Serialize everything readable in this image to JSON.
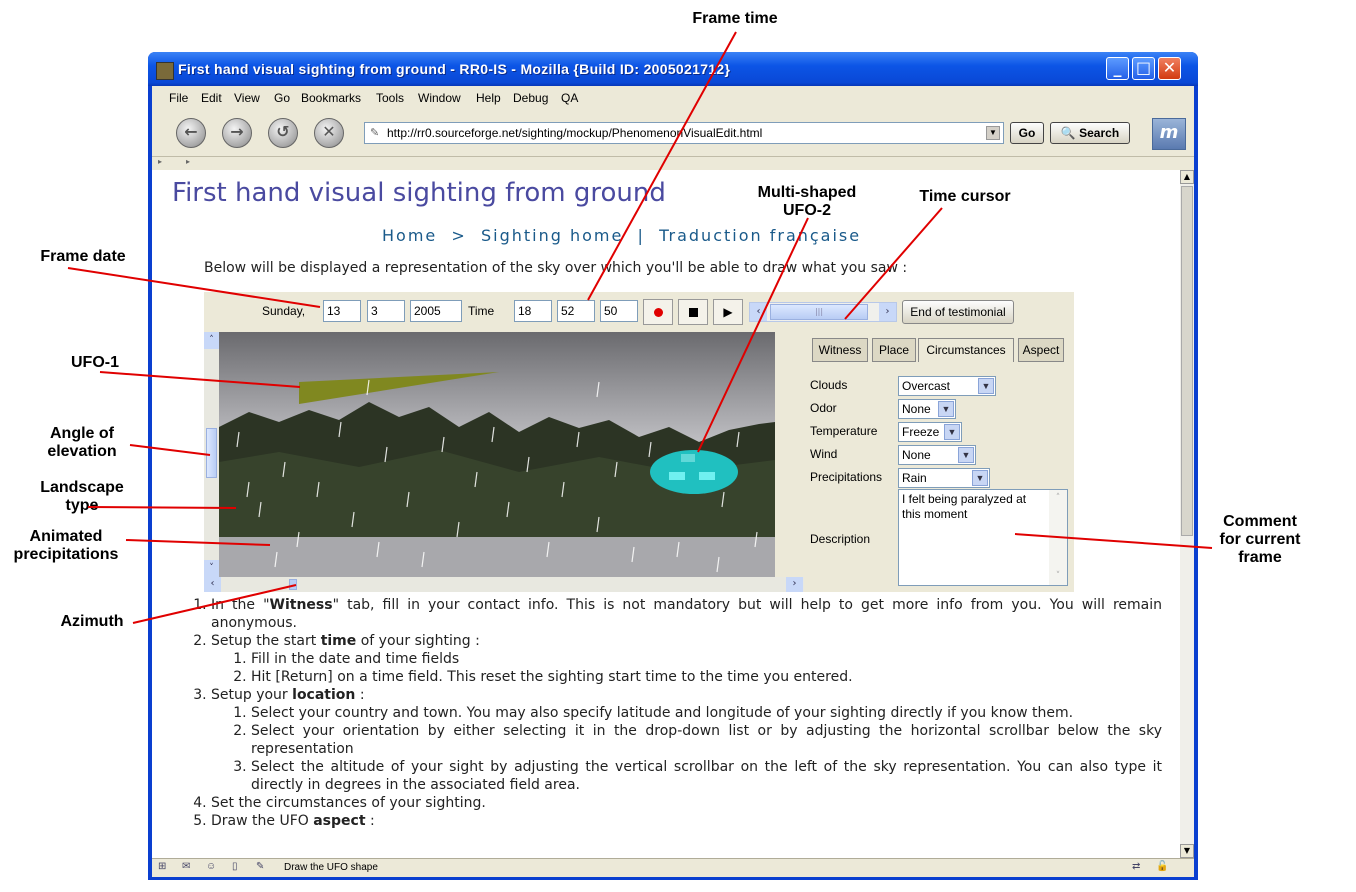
{
  "window": {
    "title": "First hand visual sighting from ground - RR0-IS - Mozilla {Build ID: 2005021712}",
    "minimize_glyph": "_",
    "maximize_glyph": "□",
    "close_glyph": "✕"
  },
  "menu": [
    "File",
    "Edit",
    "View",
    "Go",
    "Bookmarks",
    "Tools",
    "Window",
    "Help",
    "Debug",
    "QA"
  ],
  "navigation": {
    "url": "http://rr0.sourceforge.net/sighting/mockup/PhenomenonVisualEdit.html",
    "go_label": "Go",
    "search_label": "Search"
  },
  "page": {
    "title": "First hand visual sighting from ground",
    "breadcrumb": {
      "home": "Home",
      "sep1": ">",
      "sighting_home": "Sighting home",
      "sep2": "|",
      "translation": "Traduction française"
    },
    "intro": "Below will be displayed a representation of the sky over which you'll be able to draw what you saw :"
  },
  "applet": {
    "day_label": "Sunday,",
    "day": "13",
    "month": "3",
    "year": "2005",
    "time_label": "Time",
    "hour": "18",
    "minute": "52",
    "second": "50",
    "end_button": "End of testimonial",
    "tabs": [
      "Witness",
      "Place",
      "Circumstances",
      "Aspect"
    ],
    "active_tab": "Circumstances",
    "circumstances": {
      "clouds_label": "Clouds",
      "clouds_value": "Overcast",
      "odor_label": "Odor",
      "odor_value": "None",
      "temperature_label": "Temperature",
      "temperature_value": "Freeze",
      "wind_label": "Wind",
      "wind_value": "None",
      "precipitations_label": "Precipitations",
      "precipitations_value": "Rain",
      "description_label": "Description",
      "description_value": "I felt being paralyzed at this moment"
    }
  },
  "callouts": {
    "frame_time": "Frame time",
    "multi_shaped_1": "Multi-shaped",
    "multi_shaped_2": "UFO-2",
    "time_cursor": "Time cursor",
    "frame_date": "Frame date",
    "ufo1": "UFO-1",
    "angle_1": "Angle of",
    "angle_2": "elevation",
    "landscape_1": "Landscape",
    "landscape_2": "type",
    "animated_1": "Animated",
    "animated_2": "precipitations",
    "azimuth": "Azimuth",
    "comment_1": "Comment",
    "comment_2": "for current",
    "comment_3": "frame"
  },
  "steps": {
    "s1_pre": "In the \"",
    "s1_bold": "Witness",
    "s1_post": "\" tab, fill in your contact info. This is not mandatory but will help to get more info from you. You will remain anonymous.",
    "s2_pre": "Setup the start ",
    "s2_bold": "time",
    "s2_post": " of your sighting :",
    "s2_1": "Fill in the date and time fields",
    "s2_2": "Hit [Return] on a time field. This reset the sighting start time to the time you entered.",
    "s3_pre": "Setup your ",
    "s3_bold": "location",
    "s3_post": " :",
    "s3_1": "Select your country and town. You may also specify latitude and longitude of your sighting directly if you know them.",
    "s3_2": "Select your orientation by either selecting it in the drop-down list or by adjusting the horizontal scrollbar below the sky representation",
    "s3_3": "Select the altitude of your sight by adjusting the vertical scrollbar on the left of the sky representation. You can also type it directly in degrees in the associated field area.",
    "s4": "Set the circumstances of your sighting.",
    "s5_pre": "Draw the UFO ",
    "s5_bold": "aspect",
    "s5_post": " :"
  },
  "status": {
    "text": "Draw the UFO shape"
  },
  "colors": {
    "title_blue": "#0a48d6",
    "ufo1": "#808820",
    "ufo2": "#20c0c0",
    "callout_line": "#e00000"
  }
}
